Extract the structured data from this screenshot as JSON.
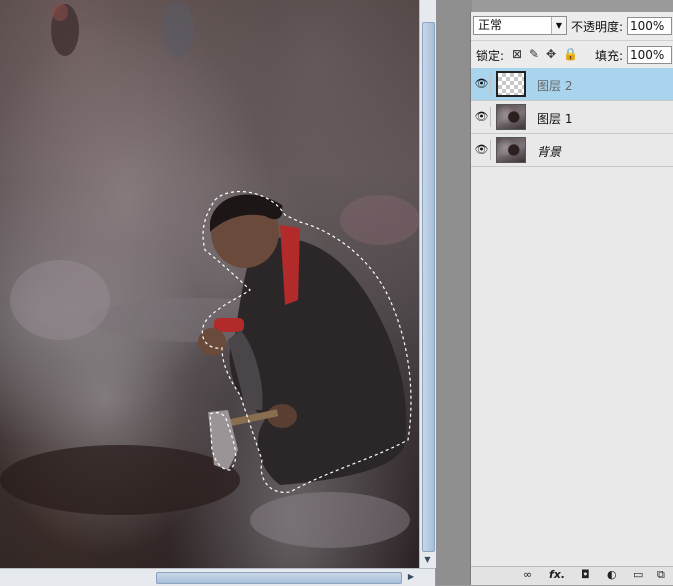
{
  "layers_panel": {
    "blend_mode": "正常",
    "opacity_label": "不透明度:",
    "opacity_value": "100%",
    "lock_label": "锁定:",
    "fill_label": "填充:",
    "fill_value": "100%",
    "layers": [
      {
        "name": "图层 2",
        "thumbnail": "transparent",
        "visible": true,
        "selected": true
      },
      {
        "name": "图层 1",
        "thumbnail": "photo",
        "visible": true,
        "selected": false
      },
      {
        "name": "背景",
        "thumbnail": "photo",
        "visible": true,
        "selected": false
      }
    ],
    "bottom_icons": [
      "link-icon",
      "fx-icon",
      "mask-icon",
      "adjustment-icon",
      "folder-icon",
      "new-layer-icon"
    ],
    "bottom_fx_label": "fx."
  },
  "colors": {
    "selected_layer": "#a9d4ee",
    "panel_bg": "#e9e9e9"
  }
}
